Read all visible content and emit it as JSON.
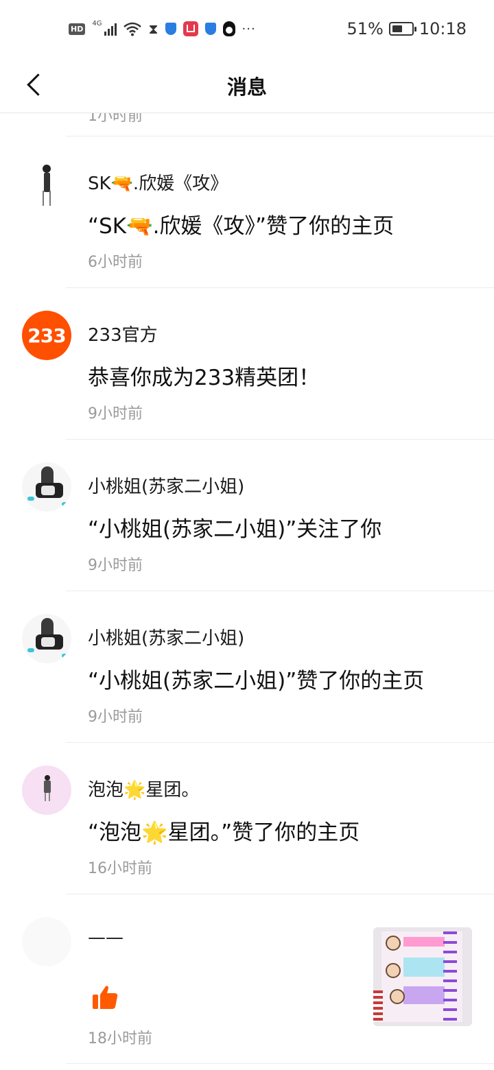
{
  "status_bar": {
    "hd": "HD",
    "network": "4G",
    "battery": "51%",
    "time": "10:18"
  },
  "header": {
    "title": "消息"
  },
  "partial_row": {
    "time": "1小时前"
  },
  "messages": [
    {
      "name": "SK🔫.欣媛《攻》",
      "content": "“SK🔫.欣媛《攻》”赞了你的主页",
      "time": "6小时前",
      "avatar": "anime-figure"
    },
    {
      "name": "233官方",
      "content": "恭喜你成为233精英团！",
      "time": "9小时前",
      "avatar": "233-logo",
      "avatar_text": "233",
      "avatar_color": "#ff4f00"
    },
    {
      "name": "小桃姐(苏家二小姐)",
      "content": "“小桃姐(苏家二小姐)”关注了你",
      "time": "9小时前",
      "avatar": "anime-girl"
    },
    {
      "name": "小桃姐(苏家二小姐)",
      "content": "“小桃姐(苏家二小姐)”赞了你的主页",
      "time": "9小时前",
      "avatar": "anime-girl"
    },
    {
      "name": "泡泡🌟星团。",
      "content": "“泡泡🌟星团。”赞了你的主页",
      "time": "16小时前",
      "avatar": "pink-figure"
    },
    {
      "name": "——",
      "time": "18小时前",
      "avatar": "blank",
      "reaction_icon": "thumbs-up-icon",
      "reaction_color": "#ff5a00",
      "thumbnail": "notebook-photo"
    }
  ]
}
